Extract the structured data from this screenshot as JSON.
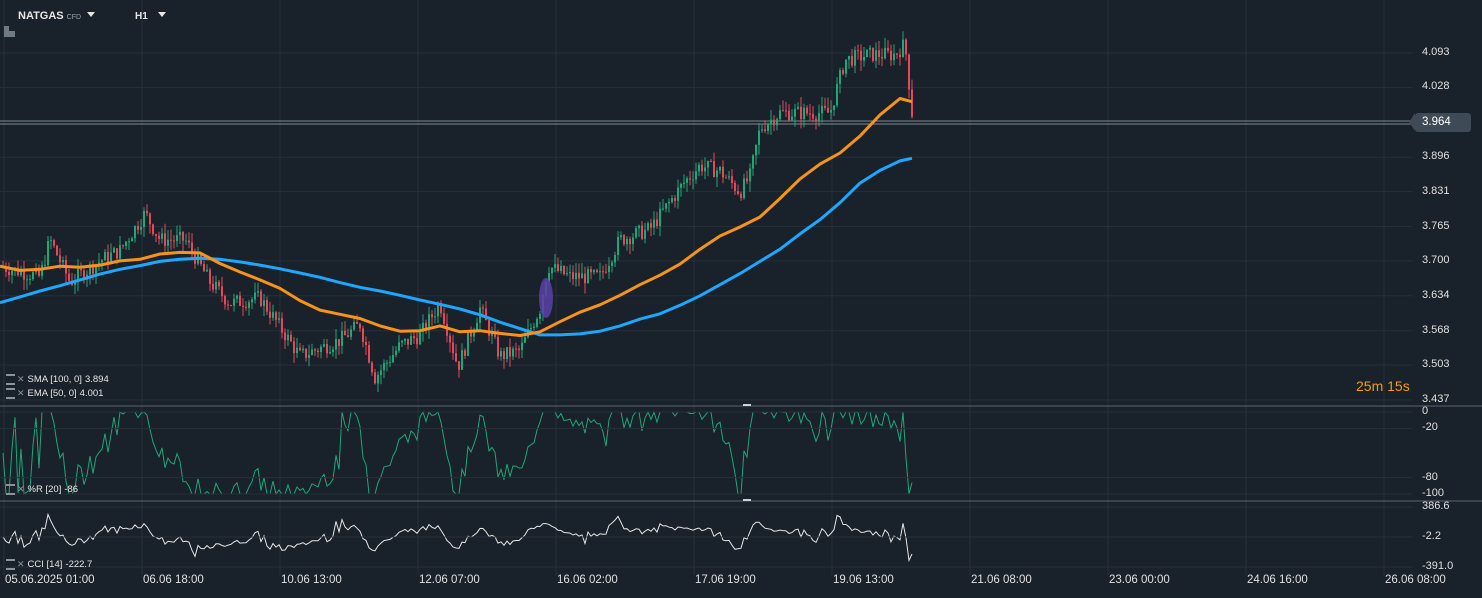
{
  "toolbar": {
    "symbol": "NATGAS",
    "symbol_type": "CFD",
    "timeframe": "H1"
  },
  "price_axis": [
    "4.093",
    "4.028",
    "3.896",
    "3.831",
    "3.765",
    "3.700",
    "3.634",
    "3.568",
    "3.503",
    "3.437"
  ],
  "current_price": "3.964",
  "countdown": {
    "minutes": "25",
    "m": "m",
    "seconds": "15",
    "s": "s"
  },
  "indicators": {
    "sma": {
      "label": "SMA [100, 0]",
      "value": "3.894",
      "color": "#1ea7ff"
    },
    "ema": {
      "label": "EMA [50, 0]",
      "value": "4.001",
      "color": "#f7931a"
    },
    "wr": {
      "label": "%R [20]",
      "value": "-86",
      "color": "#1ea877"
    },
    "cci": {
      "label": "CCI [14]",
      "value": "-222.7",
      "color": "#e6e6e6"
    }
  },
  "wr_axis": [
    "0",
    "-20",
    "-80",
    "-100"
  ],
  "cci_axis": [
    "386.6",
    "-2.2",
    "-391.0"
  ],
  "time_axis": [
    "05.06.2025  01:00",
    "06.06  18:00",
    "10.06  13:00",
    "12.06  07:00",
    "16.06  02:00",
    "17.06  19:00",
    "19.06  13:00",
    "21.06  08:00",
    "23.06  00:00",
    "24.06  16:00",
    "26.06  08:00"
  ],
  "colors": {
    "up": "#1ea877",
    "down": "#e5485a",
    "background": "#19212a",
    "grid": "#26303a",
    "highlight": "#5b3fa8"
  },
  "chart_data": {
    "type": "candlestick",
    "price_range": [
      3.437,
      4.125
    ],
    "series": [
      {
        "name": "SMA [100, 0]",
        "x": [
          0,
          20,
          40,
          60,
          80,
          100,
          120,
          140,
          160,
          180,
          200,
          220,
          240,
          260,
          280,
          300,
          320,
          340,
          360,
          380,
          400,
          420,
          440,
          460,
          480,
          500,
          520,
          540,
          560,
          580,
          600,
          620,
          640,
          660,
          680,
          700,
          720,
          740,
          760,
          780,
          800,
          820,
          840,
          860,
          880,
          900,
          912
        ],
        "values": [
          3.621,
          3.632,
          3.643,
          3.653,
          3.664,
          3.675,
          3.684,
          3.691,
          3.699,
          3.703,
          3.705,
          3.703,
          3.698,
          3.692,
          3.685,
          3.677,
          3.669,
          3.659,
          3.65,
          3.643,
          3.635,
          3.626,
          3.618,
          3.609,
          3.598,
          3.584,
          3.572,
          3.56,
          3.56,
          3.562,
          3.567,
          3.577,
          3.59,
          3.6,
          3.616,
          3.634,
          3.655,
          3.676,
          3.699,
          3.722,
          3.751,
          3.778,
          3.81,
          3.847,
          3.871,
          3.889,
          3.894
        ]
      },
      {
        "name": "EMA [50, 0]",
        "x": [
          0,
          20,
          40,
          60,
          80,
          100,
          120,
          140,
          160,
          180,
          200,
          220,
          240,
          260,
          280,
          300,
          320,
          340,
          360,
          380,
          400,
          420,
          440,
          460,
          480,
          500,
          520,
          540,
          560,
          580,
          600,
          620,
          640,
          660,
          680,
          700,
          720,
          740,
          760,
          780,
          800,
          820,
          840,
          860,
          880,
          900,
          912
        ],
        "values": [
          3.69,
          3.682,
          3.684,
          3.69,
          3.688,
          3.692,
          3.7,
          3.703,
          3.713,
          3.716,
          3.715,
          3.695,
          3.679,
          3.664,
          3.648,
          3.625,
          3.607,
          3.599,
          3.591,
          3.577,
          3.567,
          3.568,
          3.577,
          3.566,
          3.568,
          3.563,
          3.559,
          3.566,
          3.585,
          3.603,
          3.617,
          3.635,
          3.655,
          3.673,
          3.694,
          3.722,
          3.747,
          3.764,
          3.783,
          3.818,
          3.855,
          3.883,
          3.904,
          3.936,
          3.976,
          4.007,
          4.001
        ]
      }
    ],
    "wr_range": [
      -100,
      0
    ],
    "cci_range": [
      -391.0,
      386.6
    ]
  }
}
